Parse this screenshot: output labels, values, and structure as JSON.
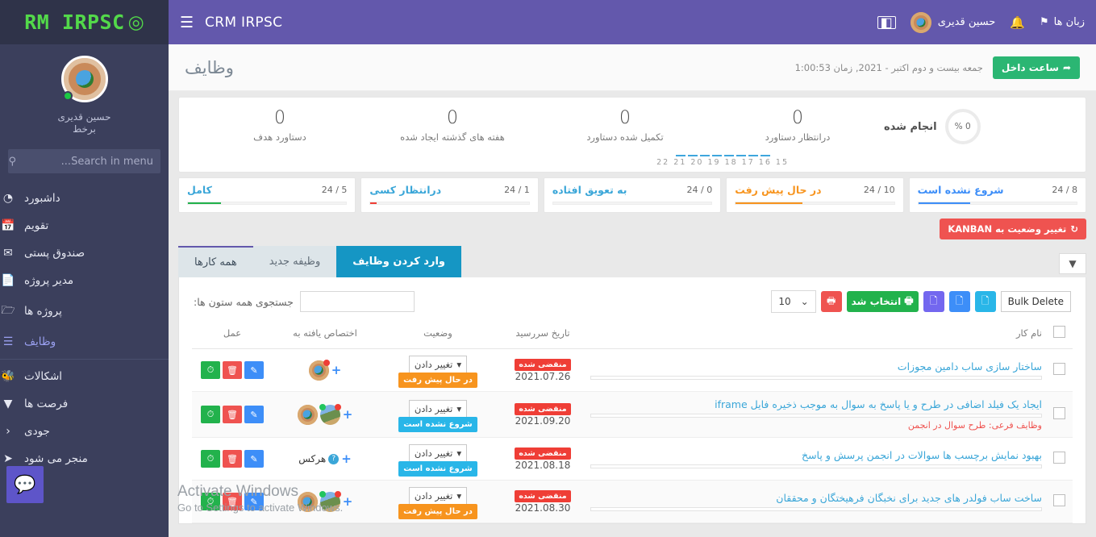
{
  "brand": {
    "logo_icon": "crm-logo-icon",
    "name": "RM IRPSC"
  },
  "topbar": {
    "hamburger_icon": "hamburger-icon",
    "title": "CRM IRPSC",
    "user_name": "حسین قدیری",
    "bell_icon": "bell-icon",
    "flag_icon": "flag-icon",
    "languages_label": "زبان ها",
    "panel_icon": "side-panel-icon"
  },
  "sidebar": {
    "profile": {
      "name": "حسین قدیری",
      "status": "برخط",
      "avatar": "user-avatar",
      "online_dot": "online-status-dot"
    },
    "search": {
      "placeholder": "Search in menu...",
      "value": "",
      "icon": "search-icon"
    },
    "items": [
      {
        "label": "داشبورد",
        "icon": "dashboard-icon",
        "active": false
      },
      {
        "label": "تقویم",
        "icon": "calendar-icon",
        "active": false
      },
      {
        "label": "صندوق پستی",
        "icon": "mail-icon",
        "active": false
      },
      {
        "label": "مدیر پروژه",
        "icon": "file-icon",
        "active": false
      },
      {
        "label": "پروژه ها",
        "icon": "folder-icon",
        "active": false
      },
      {
        "label": "وظایف",
        "icon": "tasks-icon",
        "active": true
      },
      {
        "label": "اشکالات",
        "icon": "bug-icon",
        "active": false
      },
      {
        "label": "فرصت ها",
        "icon": "funnel-icon",
        "active": false
      },
      {
        "label": "جودی",
        "icon": "chart-icon",
        "active": false
      },
      {
        "label": "منجر می شود",
        "icon": "rocket-icon",
        "active": false
      }
    ],
    "chat_icon": "chat-bubble-icon"
  },
  "pagehead": {
    "title": "وظایف",
    "datetime": "جمعه بیست و دوم اکتبر - 2021, زمان  1:00:53",
    "clockin_label": "ساعت داخل",
    "clockin_icon": "clock-in-icon"
  },
  "stats": {
    "done": {
      "label": "انجام شده",
      "percent": "0 %"
    },
    "cards": [
      {
        "num": "0",
        "label": "درانتظار دستاورد"
      },
      {
        "num": "0",
        "label": "تکمیل شده دستاورد"
      },
      {
        "num": "0",
        "label": "هفته های گذشته ایجاد شده"
      },
      {
        "num": "0",
        "label": "دستاورد هدف"
      }
    ],
    "sparkline_labels": "22 21 20 19 18 17 16 15"
  },
  "progress_cards": [
    {
      "title": "کامل",
      "count": "24 / 5",
      "color": "#22b24c",
      "pct": 21
    },
    {
      "title": "درانتظار کسی",
      "count": "24 / 1",
      "color": "#ef3e36",
      "pct": 4
    },
    {
      "title": "به تعویق افتاده",
      "count": "24 / 0",
      "color": "#9e9e9e",
      "pct": 0
    },
    {
      "title": "در حال پیش رفت",
      "count": "24 / 10",
      "color": "#f7941e",
      "pct": 42
    },
    {
      "title": "شروع نشده است",
      "count": "24 / 8",
      "color": "#3d8ef8",
      "pct": 33
    }
  ],
  "kanban": {
    "label": "تغییر وضعیت به KANBAN",
    "icon": "refresh-icon"
  },
  "tabs": [
    {
      "label": "همه کارها",
      "state": "active-line"
    },
    {
      "label": "وظیفه جدید",
      "state": ""
    },
    {
      "label": "وارد کردن وظایف",
      "state": "active-fill"
    }
  ],
  "filter_button": {
    "icon": "filter-icon"
  },
  "table_tools": {
    "search_label": "جستجوی همه ستون ها:",
    "search_value": "",
    "page_length": "10",
    "chevron_icon": "chevron-down-icon",
    "bulk_delete": "Bulk Delete",
    "buttons": [
      {
        "name": "export-pdf-button",
        "icon": "pdf-icon",
        "color": "cyan"
      },
      {
        "name": "export-excel-button",
        "icon": "excel-icon",
        "color": "blue"
      },
      {
        "name": "export-csv-button",
        "icon": "csv-icon",
        "color": "purple"
      },
      {
        "name": "print-selected-button",
        "label": "انتخاب شد",
        "icon": "printer-icon",
        "color": "green"
      },
      {
        "name": "print-button",
        "icon": "printer-icon",
        "color": "red"
      }
    ]
  },
  "table": {
    "headers": [
      "",
      "نام کار",
      "تاریخ سررسید",
      "وضعیت",
      "اختصاص یافته به",
      "عمل"
    ],
    "rows": [
      {
        "title": "ساختار سازی ساب دامین مجوزات",
        "subtask": "",
        "badge": "منقضی شده",
        "due": "2021.07.26",
        "status": "در حال پیش رفت",
        "status_class": "chip-prog",
        "change_label": "تغییر دادن",
        "assignees": [
          "globe"
        ],
        "anyone": false
      },
      {
        "title": "ایجاد یک فیلد اضافی در طرح و یا پاسخ به سوال به موجب ذخیره فایل iframe",
        "subtask": "وظایف فرعی: طرح سوال در انجمن",
        "badge": "منقضی شده",
        "due": "2021.09.20",
        "status": "شروع نشده است",
        "status_class": "chip-notstart",
        "change_label": "تغییر دادن",
        "assignees": [
          "globe",
          "photo"
        ],
        "anyone": false
      },
      {
        "title": "بهبود نمایش برچسب ها سوالات در انجمن پرسش و پاسخ",
        "subtask": "",
        "badge": "منقضی شده",
        "due": "2021.08.18",
        "status": "شروع نشده است",
        "status_class": "chip-notstart",
        "change_label": "تغییر دادن",
        "assignees": [],
        "anyone": true,
        "anyone_label": "هرکس"
      },
      {
        "title": "ساخت ساب فولدر های جدید برای نخبگان فرهیختگان و محققان",
        "subtask": "",
        "badge": "منقضی شده",
        "due": "2021.08.30",
        "status": "در حال پیش رفت",
        "status_class": "chip-prog",
        "change_label": "تغییر دادن",
        "assignees": [
          "globe",
          "photo"
        ],
        "anyone": false
      }
    ],
    "action_buttons": [
      {
        "name": "timer-button",
        "icon": "clock-icon",
        "color": "g"
      },
      {
        "name": "delete-button",
        "icon": "trash-icon",
        "color": "r"
      },
      {
        "name": "edit-button",
        "icon": "pencil-icon",
        "color": "b"
      }
    ]
  },
  "watermark": {
    "line1": "Activate Windows",
    "line2": "Go to Settings to activate Windows."
  },
  "colors": {
    "topbar": "#6358ac",
    "sidebar": "#3b3f5c",
    "accent_green": "#2bb673",
    "accent_red": "#ef5350",
    "accent_blue": "#3aa6d8",
    "tab_active": "#1596c4"
  }
}
